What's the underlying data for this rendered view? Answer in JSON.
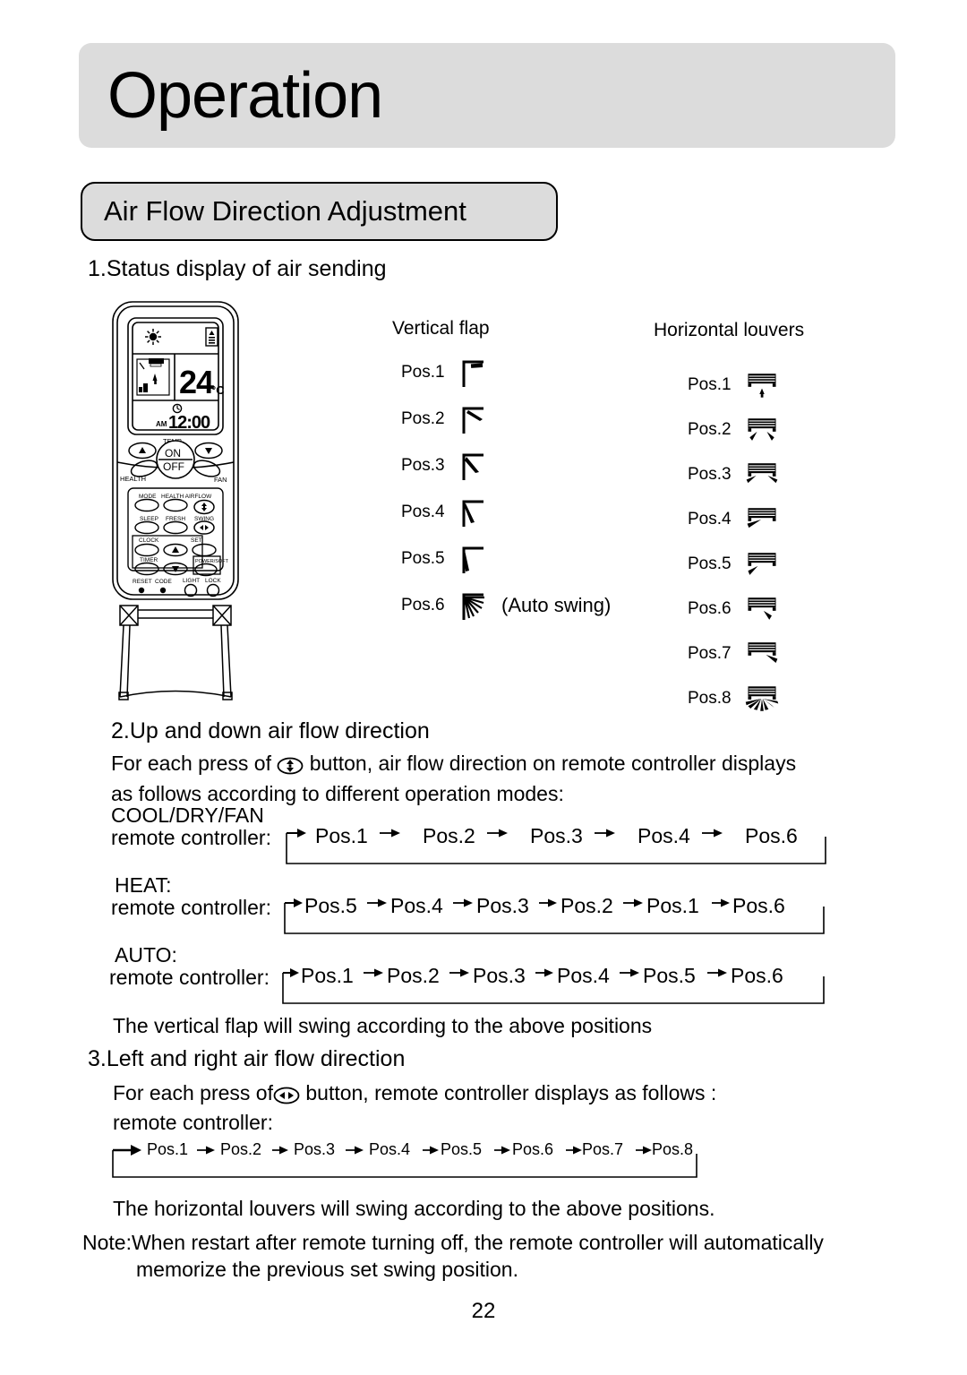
{
  "header": {
    "title": "Operation"
  },
  "section_banner": {
    "title": "Air Flow Direction Adjustment"
  },
  "sections": {
    "one": {
      "heading": "1.Status display of air sending",
      "vertical_flap": {
        "title": "Vertical flap",
        "positions": [
          {
            "label": "Pos.1",
            "icon": "vertical-flap-pos1-icon",
            "note": ""
          },
          {
            "label": "Pos.2",
            "icon": "vertical-flap-pos2-icon",
            "note": ""
          },
          {
            "label": "Pos.3",
            "icon": "vertical-flap-pos3-icon",
            "note": ""
          },
          {
            "label": "Pos.4",
            "icon": "vertical-flap-pos4-icon",
            "note": ""
          },
          {
            "label": "Pos.5",
            "icon": "vertical-flap-pos5-icon",
            "note": ""
          },
          {
            "label": "Pos.6",
            "icon": "vertical-flap-pos6-icon",
            "note": "(Auto swing)"
          }
        ]
      },
      "horizontal_louvers": {
        "title": "Horizontal louvers",
        "positions": [
          {
            "label": "Pos.1",
            "icon": "horizontal-louver-pos1-icon"
          },
          {
            "label": "Pos.2",
            "icon": "horizontal-louver-pos2-icon"
          },
          {
            "label": "Pos.3",
            "icon": "horizontal-louver-pos3-icon"
          },
          {
            "label": "Pos.4",
            "icon": "horizontal-louver-pos4-icon"
          },
          {
            "label": "Pos.5",
            "icon": "horizontal-louver-pos5-icon"
          },
          {
            "label": "Pos.6",
            "icon": "horizontal-louver-pos6-icon"
          },
          {
            "label": "Pos.7",
            "icon": "horizontal-louver-pos7-icon"
          },
          {
            "label": "Pos.8",
            "icon": "horizontal-louver-pos8-icon"
          }
        ]
      }
    },
    "two": {
      "heading": "2.Up and down air flow direction",
      "intro_before_icon": "For each press of",
      "icon": "up-down-swing-button-icon",
      "intro_after_icon": "button, air flow direction on remote controller displays",
      "intro_line2": "as follows according to different operation modes:",
      "sequences": [
        {
          "mode": "COOL/DRY/FAN",
          "prefix": "remote controller:",
          "items": [
            "Pos.1",
            "Pos.2",
            "Pos.3",
            "Pos.4",
            "Pos.6"
          ]
        },
        {
          "mode": "HEAT:",
          "prefix": "remote controller:",
          "items": [
            "Pos.5",
            "Pos.4",
            "Pos.3",
            "Pos.2",
            "Pos.1",
            "Pos.6"
          ]
        },
        {
          "mode": "AUTO:",
          "prefix": "remote controller:",
          "items": [
            "Pos.1",
            "Pos.2",
            "Pos.3",
            "Pos.4",
            "Pos.5",
            "Pos.6"
          ]
        }
      ],
      "footnote": "The vertical flap will swing according to the above positions"
    },
    "three": {
      "heading": "3.Left and right air flow direction",
      "intro_before_icon": "For each press of",
      "icon": "left-right-swing-button-icon",
      "intro_after_icon": "button, remote controller displays as follows :",
      "prefix": "remote controller:",
      "items": [
        "Pos.1",
        "Pos.2",
        "Pos.3",
        "Pos.4",
        "Pos.5",
        "Pos.6",
        "Pos.7",
        "Pos.8"
      ],
      "footnote": "The horizontal louvers will swing according to the above positions."
    }
  },
  "note": {
    "line1": "Note:When restart after remote turning off, the remote controller will automatically",
    "line2": "memorize the previous set swing position."
  },
  "page_number": "22",
  "remote": {
    "display": {
      "temperature": "24",
      "temperature_unit": "C",
      "clock_meridiem": "AM",
      "clock_time": "12:00",
      "sun_icon": "sun-mode-icon",
      "signal_icon": "signal-transmit-icon",
      "timer_icon": "clock-icon"
    },
    "buttons": {
      "temp_label": "TEMP",
      "on_label": "ON",
      "off_label": "OFF",
      "health_label": "HEALTH",
      "fan_label": "FAN",
      "mode_label": "MODE",
      "health_airflow_label": "HEALTH AIRFLOW",
      "sleep_label": "SLEEP",
      "fresh_label": "FRESH",
      "swing_label": "SWING",
      "clock_label": "CLOCK",
      "set_label": "SET",
      "timer_label": "TIMER",
      "power_soft_label": "POWER/SOFT",
      "reset_label": "RESET",
      "code_label": "CODE",
      "light_label": "LIGHT",
      "lock_label": "LOCK"
    }
  },
  "colors": {
    "banner_fill": "#dcdcdc",
    "ink": "#000000",
    "page": "#ffffff"
  }
}
